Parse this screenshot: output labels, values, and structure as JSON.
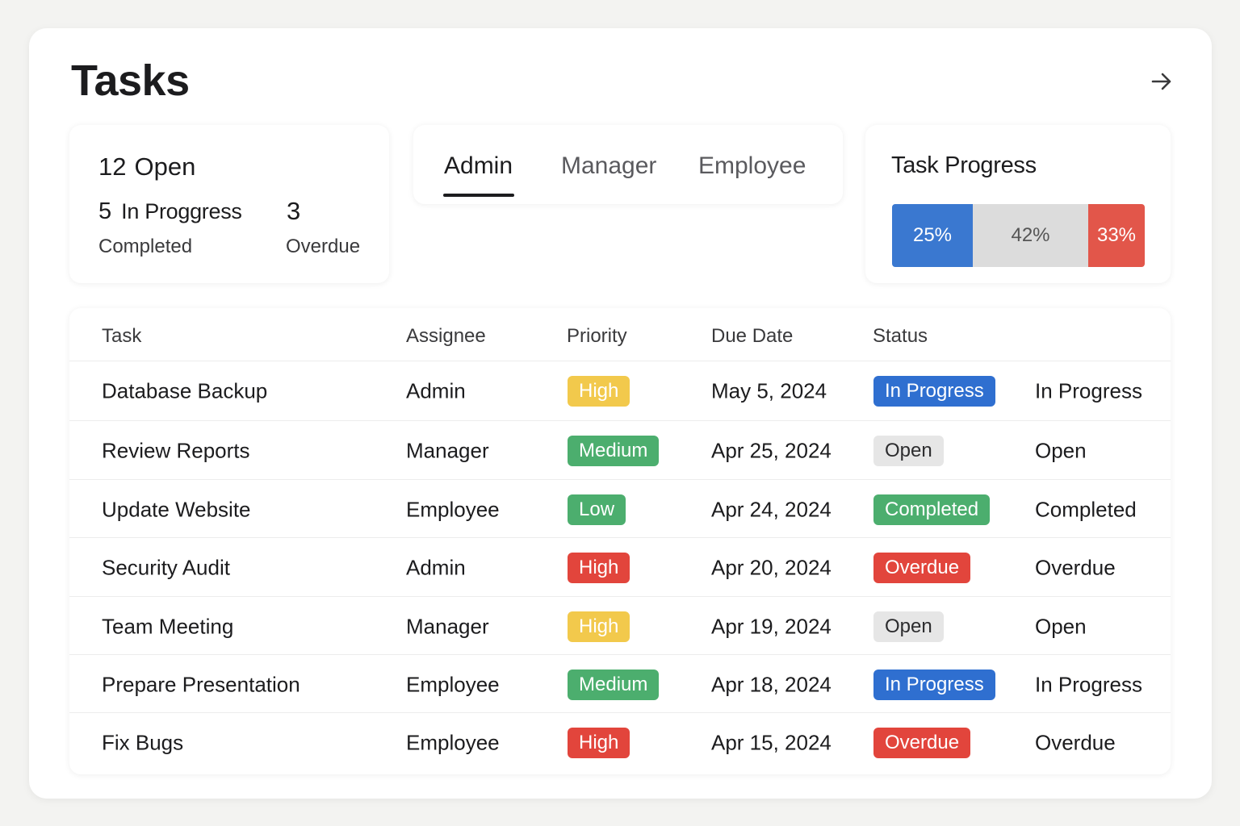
{
  "title": "Tasks",
  "stats": {
    "open_count": "12",
    "open_label": "Open",
    "in_progress_count": "5",
    "in_progress_label": "In Proggress",
    "overdue_count": "3",
    "completed_label": "Completed",
    "overdue_label": "Overdue"
  },
  "tabs": [
    {
      "label": "Admin",
      "active": true
    },
    {
      "label": "Manager",
      "active": false
    },
    {
      "label": "Employee",
      "active": false
    }
  ],
  "progress": {
    "title": "Task Progress",
    "segments": [
      {
        "label": "25%",
        "value": 25,
        "color": "#3a78d0"
      },
      {
        "label": "42%",
        "value": 42,
        "color": "#dcdcdc"
      },
      {
        "label": "33%",
        "value": 33,
        "color": "#e2564a"
      }
    ]
  },
  "table": {
    "headers": [
      "Task",
      "Assignee",
      "Priority",
      "Due Date",
      "Status"
    ],
    "rows": [
      {
        "task": "Database Backup",
        "assignee": "Admin",
        "priority": "High",
        "due": "May 5, 2024",
        "status": "In Progress",
        "status_text": "In Progress"
      },
      {
        "task": "Review Reports",
        "assignee": "Manager",
        "priority": "Medium",
        "due": "Apr 25, 2024",
        "status": "Open",
        "status_text": "Open"
      },
      {
        "task": "Update Website",
        "assignee": "Employee",
        "priority": "Low",
        "due": "Apr 24, 2024",
        "status": "Completed",
        "status_text": "Completed"
      },
      {
        "task": "Security Audit",
        "assignee": "Admin",
        "priority": "High",
        "due": "Apr 20, 2024",
        "status": "Overdue",
        "status_text": "Overdue"
      },
      {
        "task": "Team Meeting",
        "assignee": "Manager",
        "priority": "High",
        "due": "Apr 19, 2024",
        "status": "Open",
        "status_text": "Open"
      },
      {
        "task": "Prepare Presentation",
        "assignee": "Employee",
        "priority": "Medium",
        "due": "Apr 18, 2024",
        "status": "In Progress",
        "status_text": "In Progress"
      },
      {
        "task": "Fix Bugs",
        "assignee": "Employee",
        "priority": "High",
        "due": "Apr 15, 2024",
        "status": "Overdue",
        "status_text": "Overdue"
      }
    ]
  },
  "colors": {
    "priority": {
      "High_yellow": "#f2c94c",
      "High_red": "#e2453c",
      "Medium": "#4cae6e",
      "Low": "#4cae6e"
    },
    "status": {
      "In Progress": "#2f6fd0",
      "Open": "#e6e6e6",
      "Completed": "#4cae6e",
      "Overdue": "#e2453c"
    }
  },
  "priority_colors_by_row": [
    "#f2c94c",
    "#4cae6e",
    "#4cae6e",
    "#e2453c",
    "#f2c94c",
    "#4cae6e",
    "#e2453c"
  ],
  "icons": {
    "next": "arrow-right-icon"
  }
}
